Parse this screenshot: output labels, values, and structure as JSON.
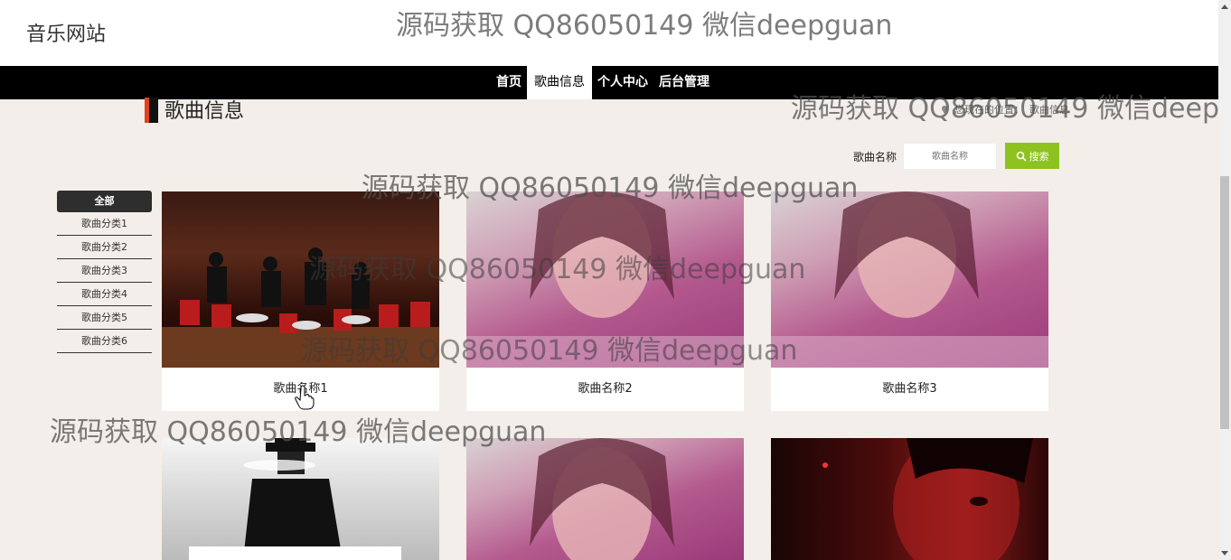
{
  "header": {
    "site_title": "音乐网站"
  },
  "nav": {
    "items": [
      {
        "label": "首页",
        "active": false
      },
      {
        "label": "歌曲信息",
        "active": true
      },
      {
        "label": "个人中心",
        "active": false
      },
      {
        "label": "后台管理",
        "active": false
      }
    ]
  },
  "page": {
    "heading": "歌曲信息",
    "location_prefix": "您现在的位置：",
    "location_current": "歌曲信息"
  },
  "search": {
    "label": "歌曲名称",
    "placeholder": "歌曲名称",
    "button": "搜索",
    "button_color": "#8dc21f"
  },
  "categories": {
    "all": "全部",
    "items": [
      "歌曲分类1",
      "歌曲分类2",
      "歌曲分类3",
      "歌曲分类4",
      "歌曲分类5",
      "歌曲分类6"
    ]
  },
  "songs": [
    {
      "name": "歌曲名称1"
    },
    {
      "name": "歌曲名称2"
    },
    {
      "name": "歌曲名称3"
    },
    {
      "name": ""
    },
    {
      "name": ""
    },
    {
      "name": ""
    }
  ],
  "watermark": "源码获取 QQ86050149 微信deepguan",
  "colors": {
    "accent": "#e2401a",
    "nav_bg": "#000000"
  }
}
